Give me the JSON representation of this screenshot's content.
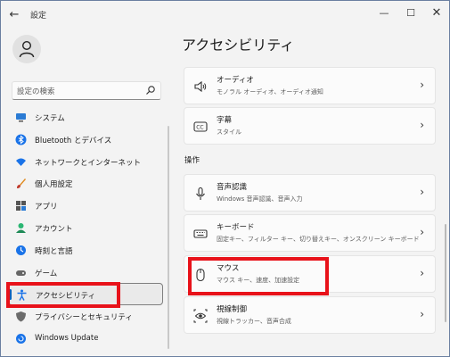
{
  "window": {
    "title": "設定",
    "back_icon": "arrow-left-icon",
    "controls": [
      "minimize-icon",
      "maximize-icon",
      "close-icon"
    ]
  },
  "search": {
    "placeholder": "設定の検索",
    "icon": "search-icon"
  },
  "sidebar": {
    "items": [
      {
        "label": "システム",
        "icon": "monitor-icon",
        "selected": false
      },
      {
        "label": "Bluetooth とデバイス",
        "icon": "bluetooth-icon",
        "selected": false
      },
      {
        "label": "ネットワークとインターネット",
        "icon": "wifi-icon",
        "selected": false
      },
      {
        "label": "個人用設定",
        "icon": "brush-icon",
        "selected": false
      },
      {
        "label": "アプリ",
        "icon": "apps-icon",
        "selected": false
      },
      {
        "label": "アカウント",
        "icon": "person-icon",
        "selected": false
      },
      {
        "label": "時刻と言語",
        "icon": "globe-clock-icon",
        "selected": false
      },
      {
        "label": "ゲーム",
        "icon": "gamepad-icon",
        "selected": false
      },
      {
        "label": "アクセシビリティ",
        "icon": "accessibility-icon",
        "selected": true
      },
      {
        "label": "プライバシーとセキュリティ",
        "icon": "shield-icon",
        "selected": false
      },
      {
        "label": "Windows Update",
        "icon": "update-icon",
        "selected": false
      }
    ]
  },
  "main": {
    "title": "アクセシビリティ",
    "section_header": "操作",
    "cards": [
      {
        "title": "オーディオ",
        "subtitle": "モノラル オーディオ、オーディオ通知",
        "icon": "speaker-icon"
      },
      {
        "title": "字幕",
        "subtitle": "スタイル",
        "icon": "closed-captions-icon"
      },
      {
        "title": "音声認識",
        "subtitle": "Windows 音声認識、音声入力",
        "icon": "microphone-icon"
      },
      {
        "title": "キーボード",
        "subtitle": "固定キー、フィルター キー、切り替えキー、オンスクリーン キーボード",
        "icon": "keyboard-icon"
      },
      {
        "title": "マウス",
        "subtitle": "マウス キー、速度、加速設定",
        "icon": "mouse-icon"
      },
      {
        "title": "視線制御",
        "subtitle": "視線トラッカー、音声合成",
        "icon": "eye-control-icon"
      }
    ]
  },
  "colors": {
    "accent": "#005fb8",
    "highlight": "#e8121a",
    "background": "#f3f3f3"
  }
}
